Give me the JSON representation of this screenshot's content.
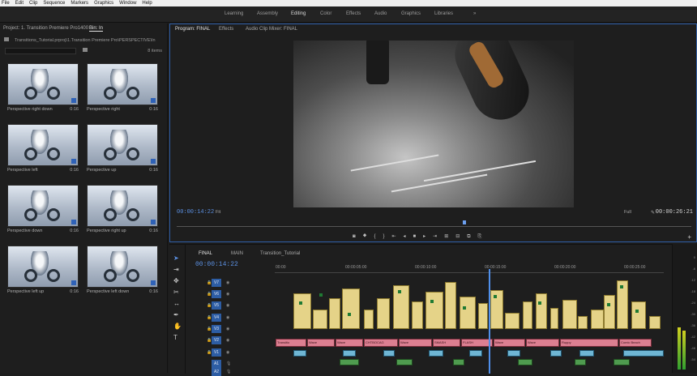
{
  "menu": [
    "File",
    "Edit",
    "Clip",
    "Sequence",
    "Markers",
    "Graphics",
    "Window",
    "Help"
  ],
  "workspaces": {
    "items": [
      "Learning",
      "Assembly",
      "Editing",
      "Color",
      "Effects",
      "Audio",
      "Graphics",
      "Libraries"
    ],
    "more": "»",
    "active": "Editing"
  },
  "project": {
    "tab_project": "Project: 1. Transition Premiere Pro1400",
    "tab_bin": "Bin: In",
    "path": "Transitions_Tutorial.prproj\\1.Transition Premiere Pro\\PERSPECTIVE\\In",
    "item_count": "8 items",
    "clips": [
      {
        "name": "Perspective  right down",
        "duration": "0:16"
      },
      {
        "name": "Perspective  right",
        "duration": "0:16"
      },
      {
        "name": "Perspective  left",
        "duration": "0:16"
      },
      {
        "name": "Perspective  up",
        "duration": "0:16"
      },
      {
        "name": "Perspective  down",
        "duration": "0:16"
      },
      {
        "name": "Perspective  right up",
        "duration": "0:16"
      },
      {
        "name": "Perspective  left up",
        "duration": "0:16"
      },
      {
        "name": "Perspective  left down",
        "duration": "0:16"
      }
    ]
  },
  "monitor": {
    "tab_program": "Program: FINAL",
    "tab_effects": "Effects",
    "tab_mixer": "Audio Clip Mixer: FINAL",
    "timecode_current": "00:00:14:22",
    "timecode_duration": "00:00:26:21",
    "zoom": "Fit",
    "resolution": "Full",
    "playhead_fraction": 0.556
  },
  "transport": [
    "◙",
    "⯁",
    "{",
    "}",
    "⇤",
    "◂",
    "■",
    "▸",
    "⇥",
    "⊞",
    "⊟",
    "⧉",
    "⎘"
  ],
  "timeline": {
    "tabs": [
      "FINAL",
      "MAIN",
      "Transition_Tutorial"
    ],
    "timecode": "00:00:14:22",
    "ruler_ticks": [
      "00:00",
      "00:00:05:00",
      "00:00:10:00",
      "00:00:15:00",
      "00:00:20:00",
      "00:00:25:00"
    ],
    "video_tracks": [
      "V7",
      "V6",
      "V5",
      "V4",
      "V3",
      "V2",
      "V1"
    ],
    "audio_tracks": [
      "A1",
      "A2"
    ],
    "pink_clip_labels": [
      "Transitio",
      "Wave",
      "Wave",
      "CHTBOCAG",
      "Wave",
      "SMASH",
      "FLASH",
      "Wave",
      "Wave",
      "Ruppy",
      "Comic Beach"
    ]
  },
  "meter": {
    "scale": [
      "0",
      "-6",
      "-12",
      "-18",
      "-24",
      "-30",
      "-36",
      "-42",
      "-48",
      "-54"
    ],
    "left_level": 0.35,
    "right_level": 0.32
  }
}
